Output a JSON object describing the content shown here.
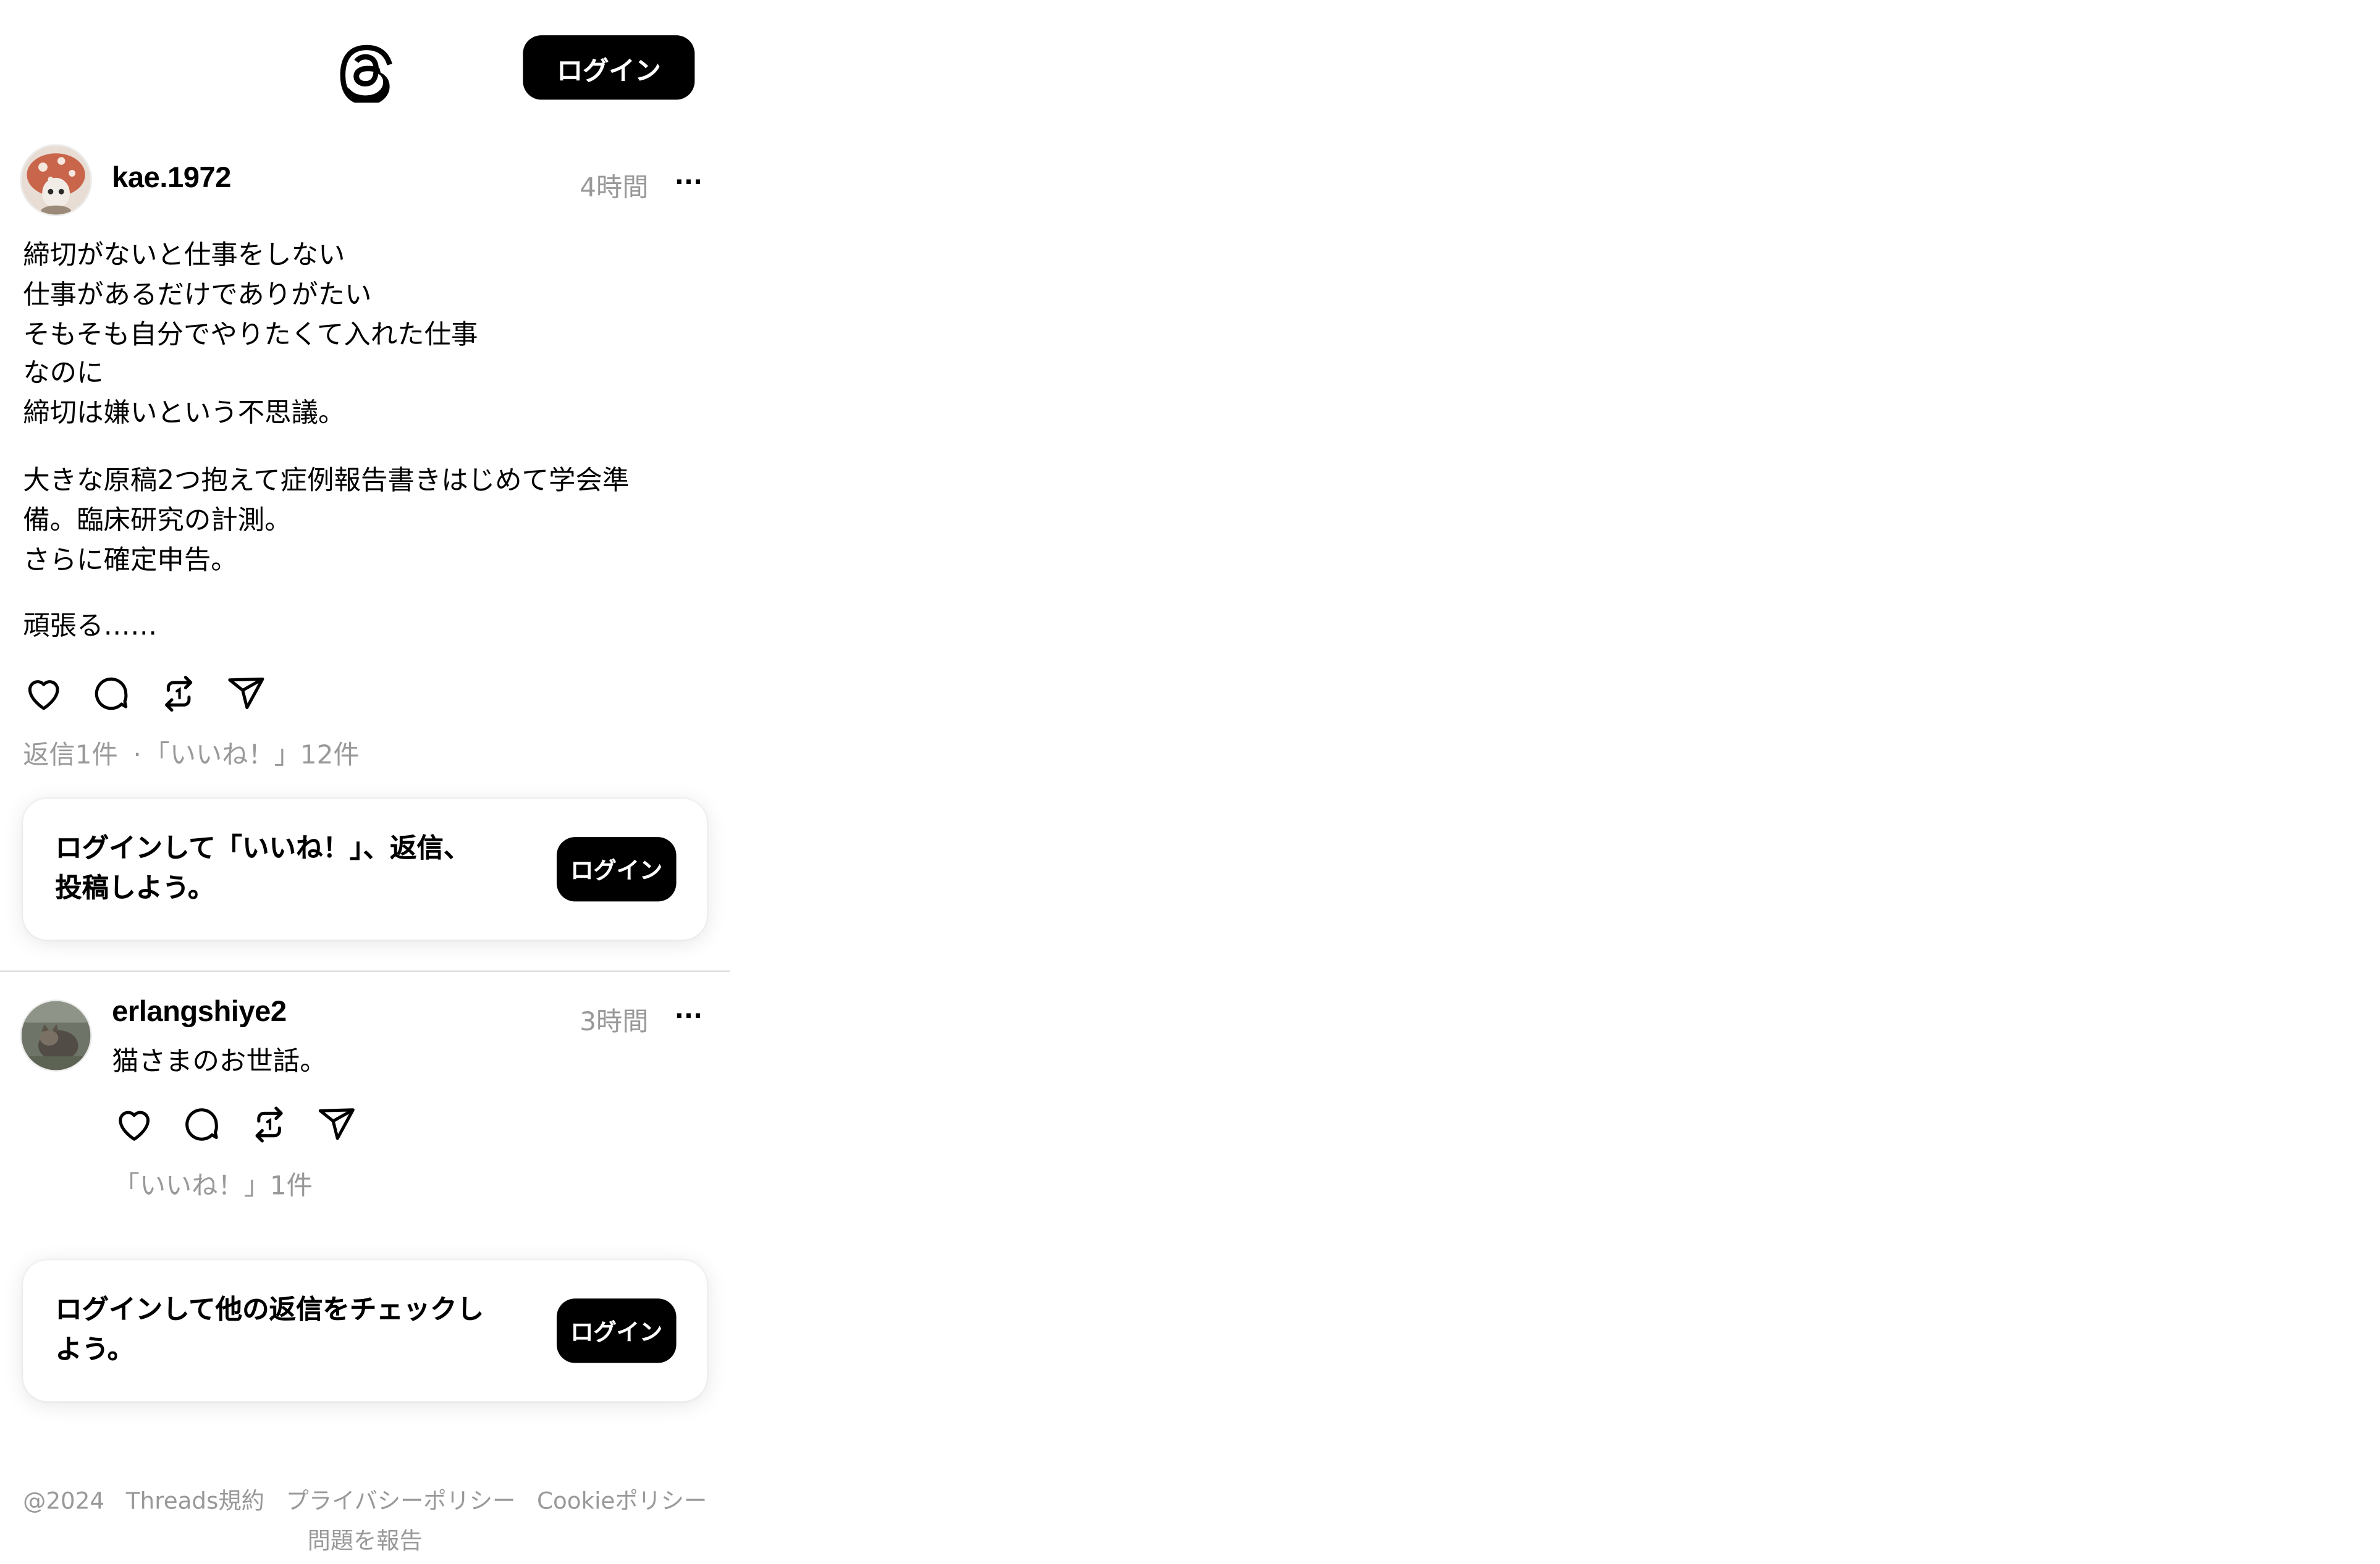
{
  "header": {
    "logo_icon": "threads-logo-icon",
    "login_label": "ログイン"
  },
  "post": {
    "username": "kae.1972",
    "time": "4時間",
    "more_icon": "more-icon",
    "more_label": "···",
    "paragraphs": [
      [
        "締切がないと仕事をしない",
        "仕事があるだけでありがたい",
        "そもそも自分でやりたくて入れた仕事",
        "なのに",
        "締切は嫌いという不思議。"
      ],
      [
        "大きな原稿2つ抱えて症例報告書きはじめて学会準",
        "備。臨床研究の計測。",
        "さらに確定申告。"
      ],
      [
        "頑張る……"
      ]
    ],
    "actions": [
      "heart-icon",
      "comment-icon",
      "repost-icon",
      "share-icon"
    ],
    "replies": "返信1件",
    "separator": "·",
    "likes": "「いいね！」12件"
  },
  "login_card_1": {
    "message_line1": "ログインして「いいね！」、返信、",
    "message_line2": "投稿しよう。",
    "button": "ログイン"
  },
  "reply": {
    "username": "erlangshiye2",
    "time": "3時間",
    "more_label": "···",
    "text": "猫さまのお世話。",
    "actions": [
      "heart-icon",
      "comment-icon",
      "repost-icon",
      "share-icon"
    ],
    "likes": "「いいね！」1件"
  },
  "login_card_2": {
    "message_line1": "ログインして他の返信をチェックし",
    "message_line2": "よう。",
    "button": "ログイン"
  },
  "footer": {
    "copyright": "@2024",
    "links": [
      "Threads規約",
      "プライバシーポリシー",
      "Cookieポリシー",
      "問題を報告"
    ]
  }
}
